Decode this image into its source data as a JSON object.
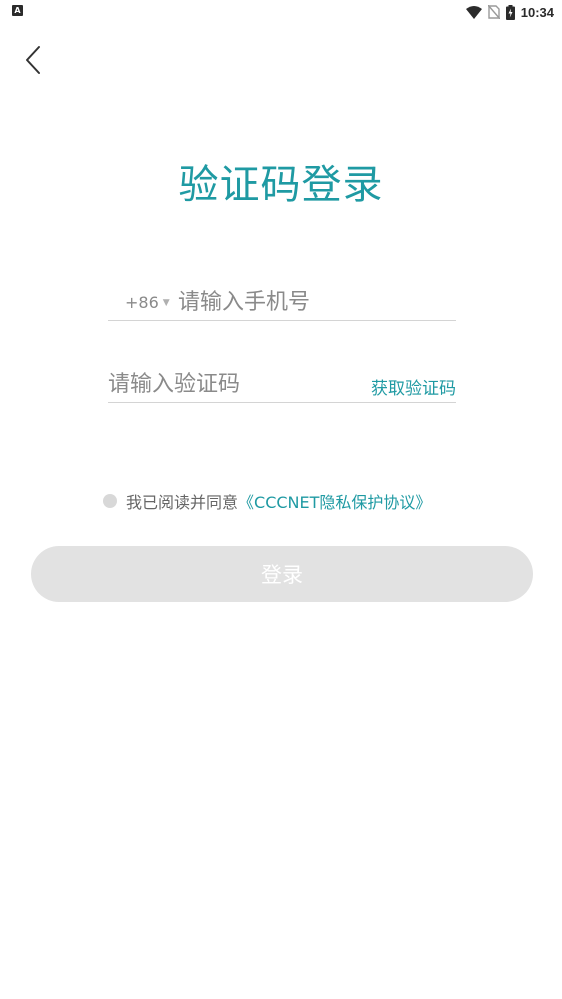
{
  "status_bar": {
    "left_icon_letter": "A",
    "time": "10:34",
    "icons": [
      "wifi-icon",
      "no-sim-icon",
      "battery-charging-icon"
    ]
  },
  "header": {
    "back_icon": "chevron-left-icon"
  },
  "title": "验证码登录",
  "phone": {
    "country_code": "+86",
    "arrow": "▼",
    "placeholder": "请输入手机号",
    "value": ""
  },
  "code": {
    "placeholder": "请输入验证码",
    "value": "",
    "get_code_label": "获取验证码"
  },
  "agreement": {
    "checked": false,
    "prefix": "我已阅读并同意",
    "link_text": "《CCCNET隐私保护协议》"
  },
  "login": {
    "label": "登录",
    "enabled": false
  },
  "colors": {
    "accent": "#1f9aa3",
    "button_disabled": "#e2e2e2",
    "placeholder": "#8a8a8a"
  }
}
